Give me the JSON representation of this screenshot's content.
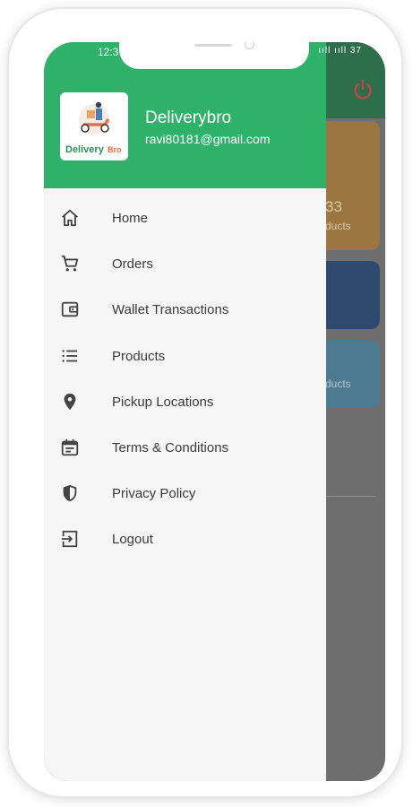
{
  "status_bar": {
    "time": "12:3",
    "indicators": "ııll ııll 37"
  },
  "drawer": {
    "brand_name": "Deliverybro",
    "email": "ravi80181@gmail.com",
    "logo_text": "Delivery Bro",
    "items": [
      {
        "label": "Home",
        "icon": "home-icon"
      },
      {
        "label": "Orders",
        "icon": "cart-icon"
      },
      {
        "label": "Wallet Transactions",
        "icon": "wallet-icon"
      },
      {
        "label": "Products",
        "icon": "list-icon"
      },
      {
        "label": "Pickup Locations",
        "icon": "location-pin-icon"
      },
      {
        "label": "Terms & Conditions",
        "icon": "calendar-icon"
      },
      {
        "label": "Privacy Policy",
        "icon": "shield-icon"
      },
      {
        "label": "Logout",
        "icon": "logout-icon"
      }
    ]
  },
  "background": {
    "card_number": "33",
    "card_label": "ducts",
    "card3_label": "ducts"
  },
  "colors": {
    "drawer_header": "#2eb26a",
    "power_icon": "#e05050"
  }
}
